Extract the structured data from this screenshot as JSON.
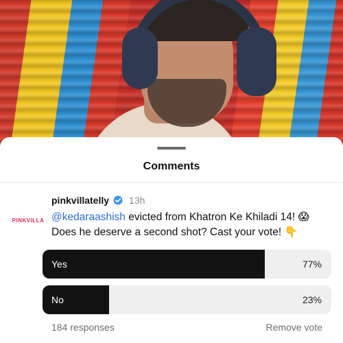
{
  "sheet": {
    "title": "Comments"
  },
  "comment": {
    "avatar_text": "PINKVILLA",
    "username": "pinkvillatelly",
    "verified_icon": "verified-badge-icon",
    "time": "13h",
    "mention": "@kedaraashish",
    "text": " evicted from Khatron Ke Khiladi 14! 😱 Does he deserve a second shot? Cast your vote! 👇"
  },
  "poll": {
    "options": [
      {
        "label": "Yes",
        "percent_text": "77%",
        "fraction": 0.77
      },
      {
        "label": "No",
        "percent_text": "23%",
        "fraction": 0.23
      }
    ],
    "responses": "184 responses",
    "remove_vote": "Remove vote"
  },
  "colors": {
    "accent_link": "#2f6fd6",
    "verified": "#3897f0",
    "poll_fill": "#131313",
    "poll_track": "#efefef",
    "brand": "#e02b55"
  }
}
